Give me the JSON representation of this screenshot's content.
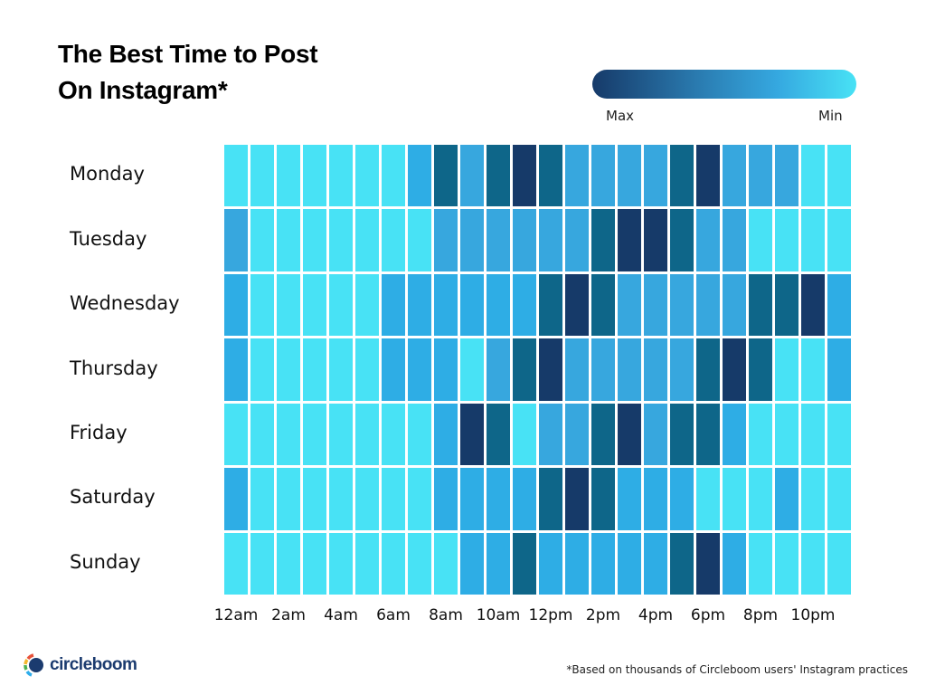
{
  "title_lines": [
    "The Best Time to Post",
    "On Instagram*"
  ],
  "legend": {
    "max_label": "Max",
    "min_label": "Min",
    "gradient": [
      "#163a69",
      "#48e2f5"
    ]
  },
  "footnote": "*Based on thousands of Circleboom users' Instagram practices",
  "logo": {
    "text": "circleboom"
  },
  "chart_data": {
    "type": "heatmap",
    "title": "The Best Time to Post On Instagram*",
    "xlabel": "",
    "ylabel": "",
    "rows": [
      "Monday",
      "Tuesday",
      "Wednesday",
      "Thursday",
      "Friday",
      "Saturday",
      "Sunday"
    ],
    "x_tick_labels": [
      "12am",
      "2am",
      "4am",
      "6am",
      "8am",
      "10am",
      "12pm",
      "2pm",
      "4pm",
      "6pm",
      "8pm",
      "10pm"
    ],
    "columns": 24,
    "scale": {
      "min": 1,
      "max": 5,
      "min_label": "Min",
      "max_label": "Max"
    },
    "level_colors": {
      "1": "#48e2f5",
      "2": "#2eade5",
      "3": "#37a7de",
      "4": "#0e6689",
      "5": "#163a69"
    },
    "values": [
      [
        1,
        1,
        1,
        1,
        1,
        1,
        1,
        2,
        4,
        3,
        4,
        5,
        4,
        3,
        3,
        3,
        3,
        4,
        5,
        3,
        3,
        3,
        1,
        1
      ],
      [
        3,
        1,
        1,
        1,
        1,
        1,
        1,
        1,
        3,
        3,
        3,
        3,
        3,
        3,
        4,
        5,
        5,
        4,
        3,
        3,
        1,
        1,
        1,
        1
      ],
      [
        2,
        1,
        1,
        1,
        1,
        1,
        2,
        2,
        2,
        2,
        2,
        2,
        4,
        5,
        4,
        3,
        3,
        3,
        3,
        3,
        4,
        4,
        5,
        2
      ],
      [
        2,
        1,
        1,
        1,
        1,
        1,
        2,
        2,
        2,
        1,
        3,
        4,
        5,
        3,
        3,
        3,
        3,
        3,
        4,
        5,
        4,
        1,
        1,
        2
      ],
      [
        1,
        1,
        1,
        1,
        1,
        1,
        1,
        1,
        2,
        5,
        4,
        1,
        3,
        3,
        4,
        5,
        3,
        4,
        4,
        2,
        1,
        1,
        1,
        1
      ],
      [
        2,
        1,
        1,
        1,
        1,
        1,
        1,
        1,
        2,
        2,
        2,
        2,
        4,
        5,
        4,
        2,
        2,
        2,
        1,
        1,
        1,
        2,
        1,
        1
      ],
      [
        1,
        1,
        1,
        1,
        1,
        1,
        1,
        1,
        1,
        2,
        2,
        4,
        2,
        2,
        2,
        2,
        2,
        4,
        5,
        2,
        1,
        1,
        1,
        1
      ]
    ],
    "legend_position": "top-right"
  }
}
